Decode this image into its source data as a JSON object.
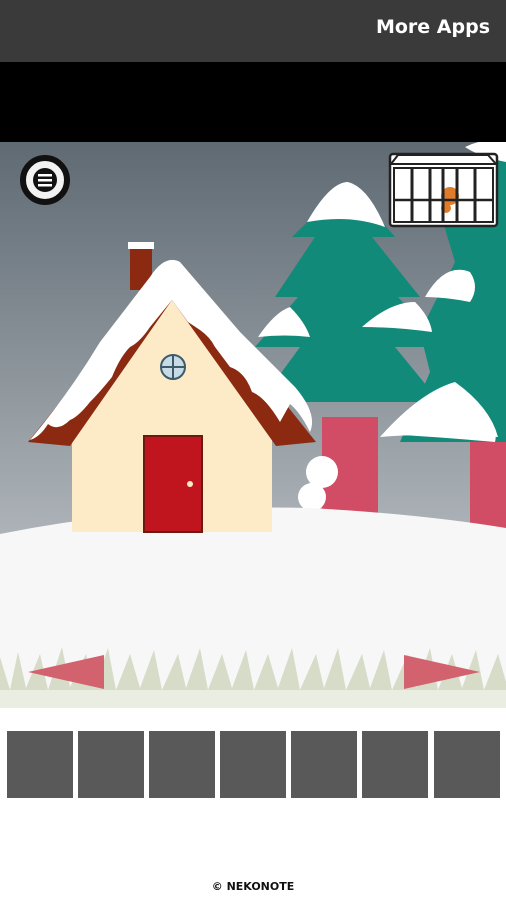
{
  "header": {
    "more_apps_label": "More Apps"
  },
  "scene": {
    "sky_top_color": "#5f6a73",
    "sky_bottom_color": "#c9cdd0",
    "tree_color": "#128a7a",
    "trunk_color": "#d14d66",
    "house_wall_color": "#fdebc7",
    "roof_color": "#8b2a10",
    "door_color": "#c0141f",
    "nav_arrow_color": "#d1626e"
  },
  "inventory": {
    "slot_count": 7,
    "slot_color": "#595959"
  },
  "footer": {
    "copyright": "© NEKONOTE"
  }
}
